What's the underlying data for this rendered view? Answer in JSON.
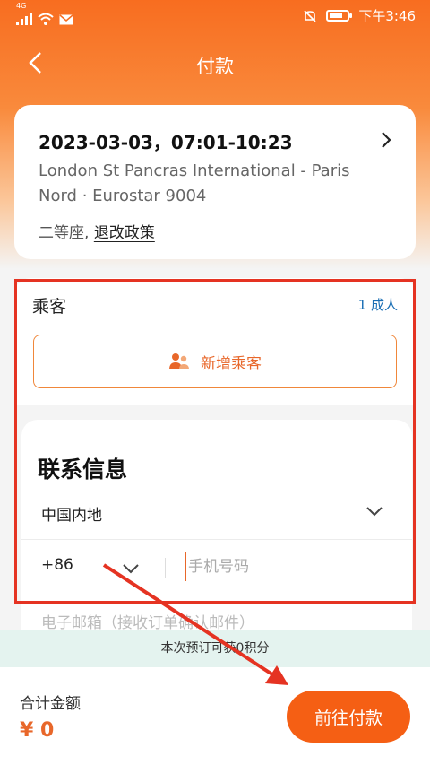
{
  "status_bar": {
    "network": "4G",
    "time": "下午3:46"
  },
  "nav": {
    "title": "付款"
  },
  "trip": {
    "date_time": "2023-03-03，07:01-10:23",
    "route": "London St Pancras International - Paris Nord · Eurostar 9004",
    "seat_class": "二等座,",
    "policy_link": "退改政策"
  },
  "passenger": {
    "title": "乘客",
    "count": "1 成人",
    "add_label": "新增乘客"
  },
  "contact": {
    "title": "联系信息",
    "region": "中国内地",
    "country_code": "+86",
    "phone_placeholder": "手机号码",
    "email_placeholder": "电子邮箱（接收订单确认邮件）"
  },
  "points_banner": "本次预订可获0积分",
  "footer": {
    "total_label": "合计金额",
    "total_value": "¥ 0",
    "pay_button": "前往付款"
  },
  "colors": {
    "brand_orange": "#f55f14",
    "annotation_red": "#e53322",
    "link_blue": "#1a6fb5"
  }
}
